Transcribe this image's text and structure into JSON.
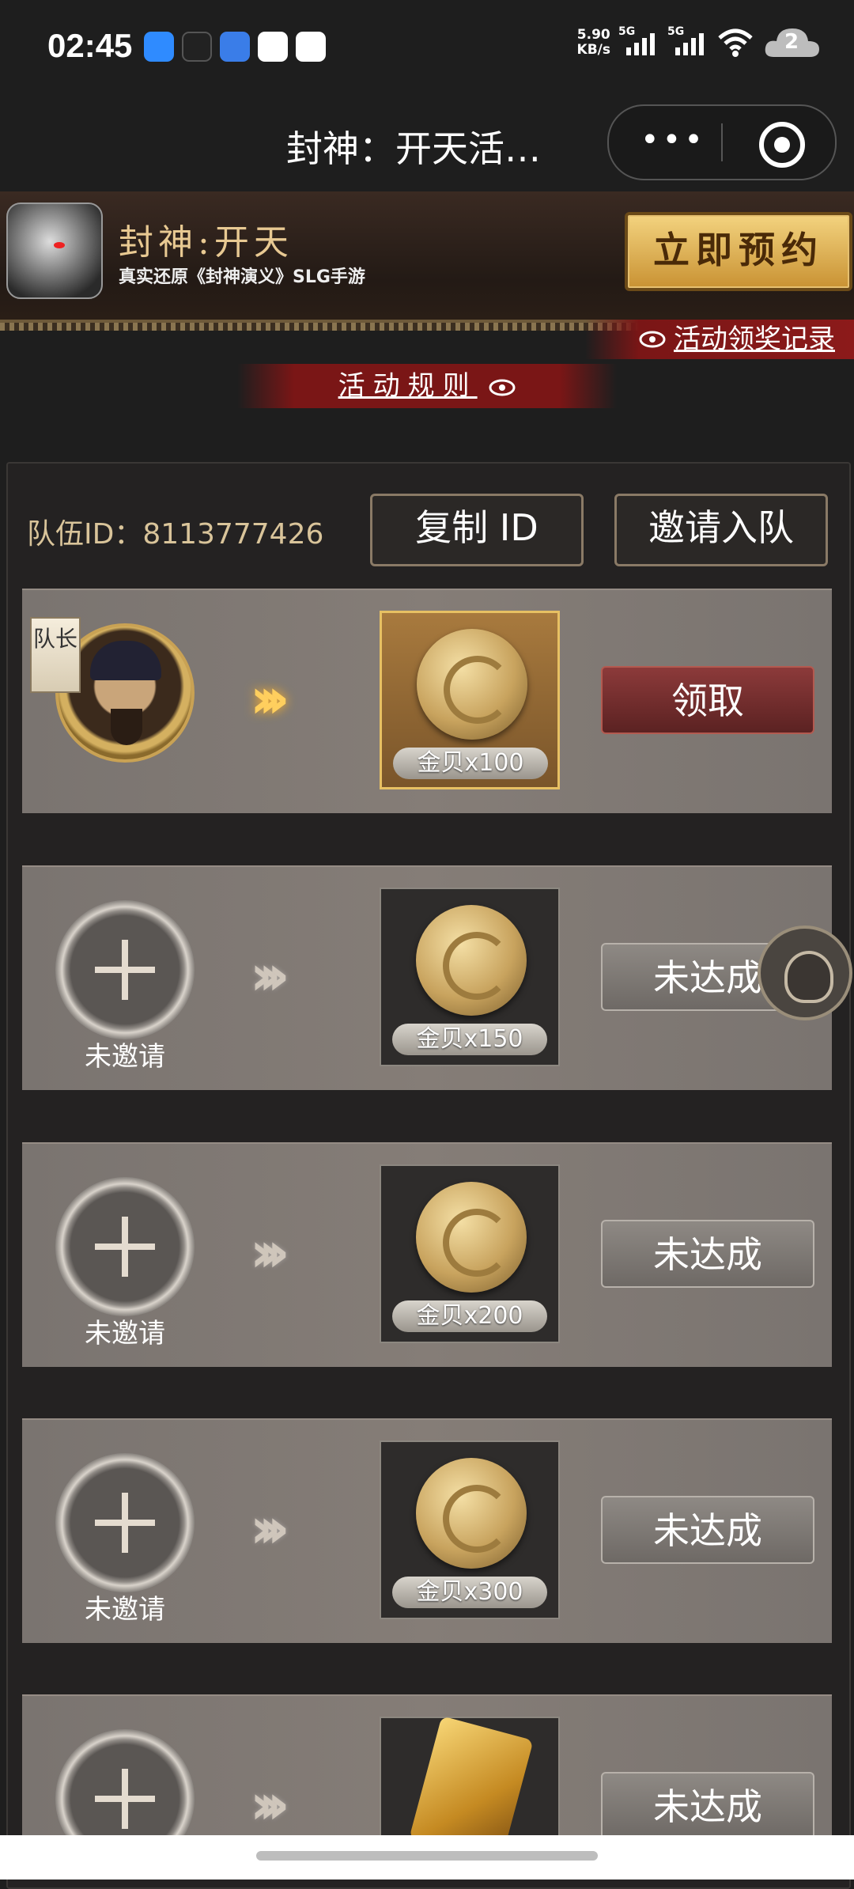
{
  "status_bar": {
    "time": "02:45",
    "net_speed_value": "5.90",
    "net_speed_unit": "KB/s",
    "signal1_label": "5G",
    "signal2_label": "5G",
    "notification_count": "2",
    "app_icons": [
      "browser-icon",
      "cat-app-icon",
      "file-app-icon",
      "qq-icon",
      "mobile-app-icon"
    ]
  },
  "title_bar": {
    "title": "封神：开天活…",
    "more_label": "•••"
  },
  "banner": {
    "game_name": "封神:开天",
    "subtitle": "真实还原《封神演义》SLG手游",
    "reserve_label": "立即预约"
  },
  "ribbons": {
    "records_label": "活动领奖记录",
    "rules_label": "活动规则"
  },
  "team": {
    "id_text": "队伍ID：8113777426",
    "copy_label": "复制 ID",
    "invite_label": "邀请入队",
    "leader_tag": "队长"
  },
  "rows": [
    {
      "slot_label": "",
      "reward_label": "金贝x100",
      "status_label": "领取"
    },
    {
      "slot_label": "未邀请",
      "reward_label": "金贝x150",
      "status_label": "未达成"
    },
    {
      "slot_label": "未邀请",
      "reward_label": "金贝x200",
      "status_label": "未达成"
    },
    {
      "slot_label": "未邀请",
      "reward_label": "金贝x300",
      "status_label": "未达成"
    },
    {
      "slot_label": "",
      "reward_label": "",
      "status_label": "未达成"
    }
  ],
  "colors": {
    "accent_gold": "#e8c992",
    "ribbon_red": "#7a1616",
    "claim_red": "#8c3a3a"
  }
}
